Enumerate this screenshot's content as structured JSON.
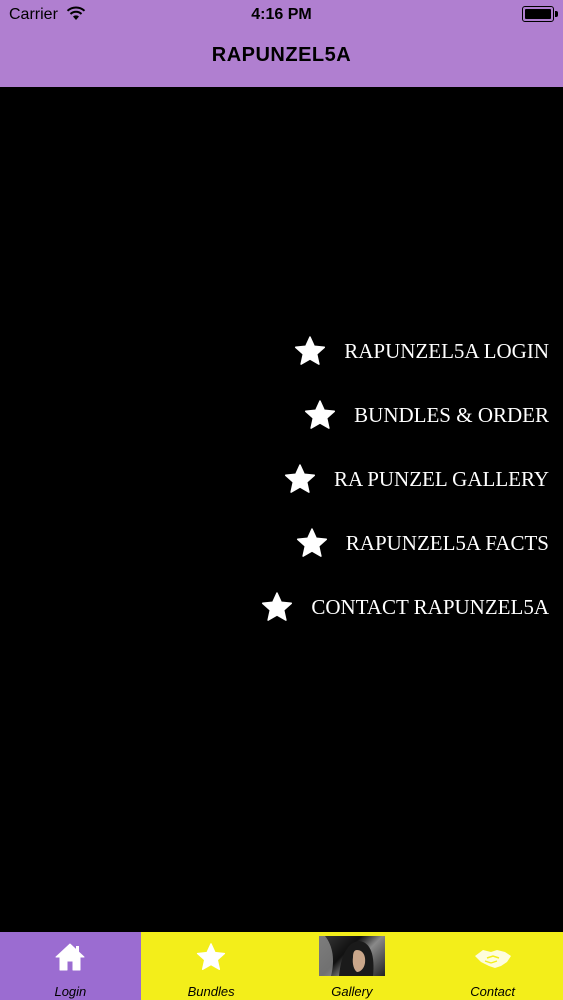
{
  "status_bar": {
    "carrier": "Carrier",
    "time": "4:16 PM"
  },
  "header": {
    "title": "RAPUNZEL5A"
  },
  "menu": {
    "icon": "star-icon",
    "items": [
      {
        "label": "RAPUNZEL5A LOGIN"
      },
      {
        "label": "BUNDLES & ORDER"
      },
      {
        "label": "RA PUNZEL GALLERY"
      },
      {
        "label": "RAPUNZEL5A FACTS"
      },
      {
        "label": "CONTACT RAPUNZEL5A"
      }
    ]
  },
  "tabbar": {
    "tabs": [
      {
        "label": "Login",
        "icon": "home-icon",
        "active": true
      },
      {
        "label": "Bundles",
        "icon": "star-icon",
        "active": false
      },
      {
        "label": "Gallery",
        "icon": "gallery-thumbnail",
        "active": false
      },
      {
        "label": "Contact",
        "icon": "handshake-icon",
        "active": false
      }
    ]
  },
  "colors": {
    "header_bg": "#b07fd0",
    "tabbar_bg": "#f3ee1a",
    "tab_active_bg": "#9b6cd1",
    "content_bg": "#000000",
    "menu_text": "#ffffff"
  }
}
